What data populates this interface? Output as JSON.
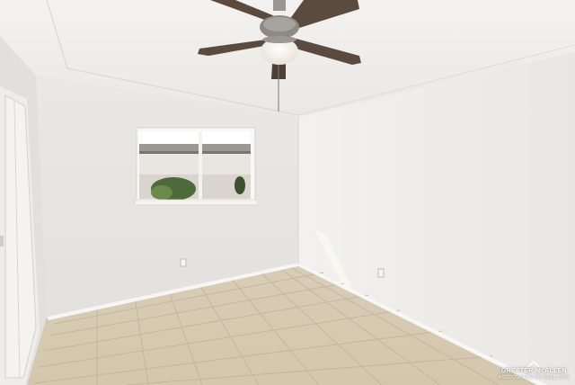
{
  "watermark": {
    "line1": "GREATER McALLEN",
    "line2": "ASSOCIATION OF REALTORS",
    "icon": "house-roof-icon"
  },
  "colors": {
    "wall_left": "#e6e4e0",
    "wall_back": "#ecebe8",
    "wall_right": "#eeedeb",
    "ceiling": "#f1f0ee",
    "floor_tile": "#d9cfb8",
    "grout": "#bdb39c",
    "baseboard": "#f7f6f4",
    "fan_blade": "#5a4a3e",
    "fan_metal": "#8e8a84"
  }
}
